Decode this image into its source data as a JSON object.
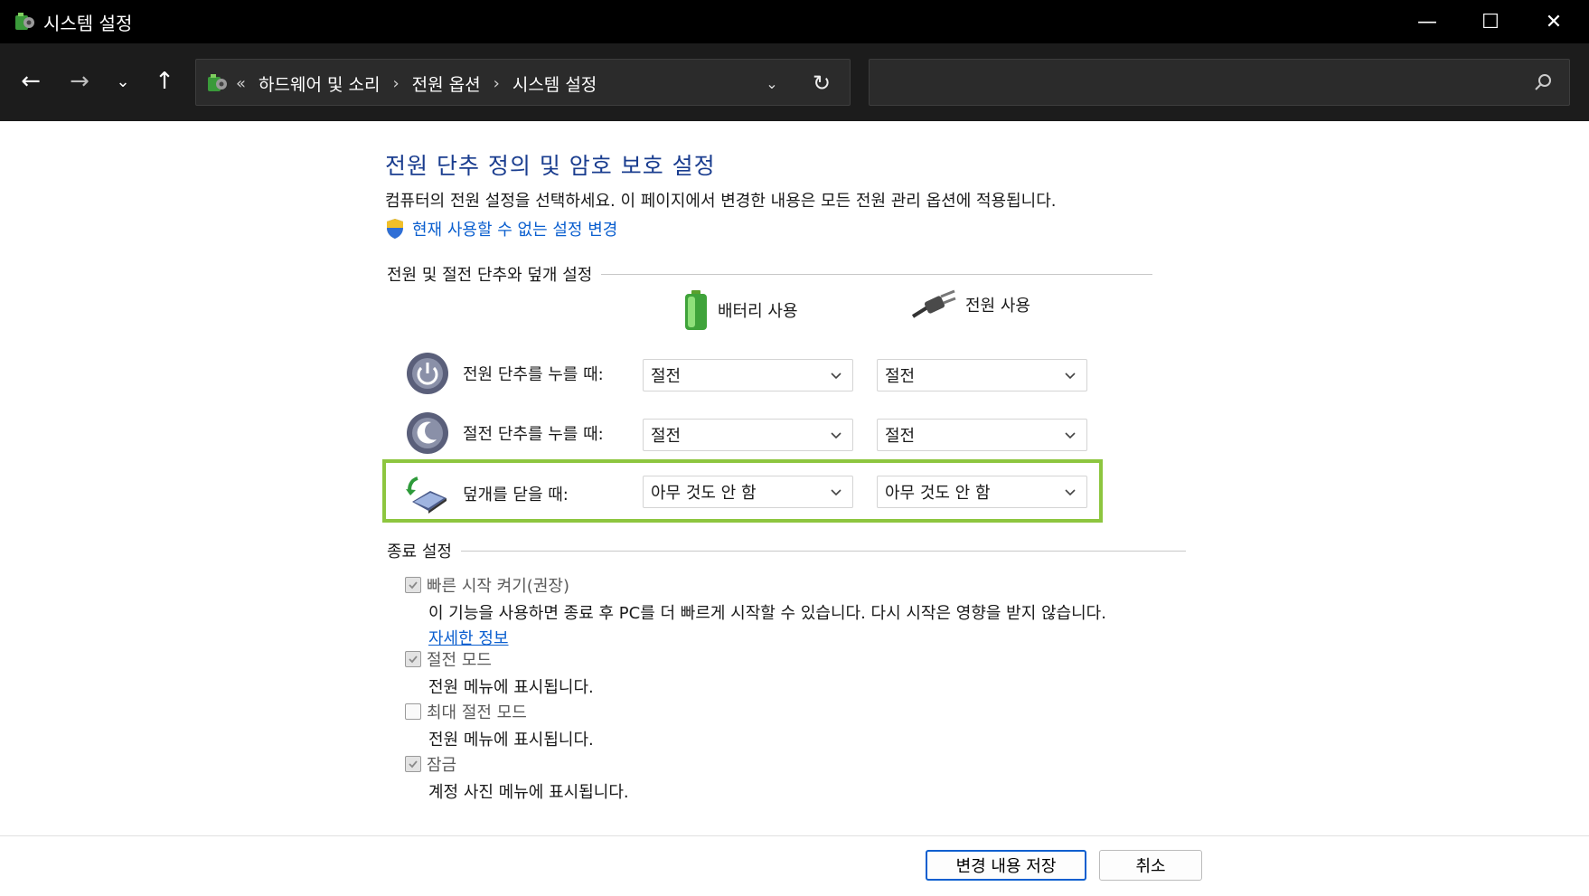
{
  "window": {
    "title": "시스템 설정",
    "minimize": "—",
    "maximize": "☐",
    "close": "✕"
  },
  "nav": {
    "back": "←",
    "forward": "→",
    "recent": "⌄",
    "up": "↑",
    "breadcrumb_prefix": "«",
    "breadcrumbs": [
      "하드웨어 및 소리",
      "전원 옵션",
      "시스템 설정"
    ],
    "separator": "›",
    "dropdown": "⌄",
    "refresh": "↻"
  },
  "search": {
    "placeholder": "",
    "value": ""
  },
  "page": {
    "heading": "전원 단추 정의 및 암호 보호 설정",
    "description": "컴퓨터의 전원 설정을 선택하세요. 이 페이지에서 변경한 내용은 모든 전원 관리 옵션에 적용됩니다.",
    "admin_link": "현재 사용할 수 없는 설정 변경"
  },
  "power_section": {
    "title": "전원 및 절전 단추와 덮개 설정",
    "col_battery": "배터리 사용",
    "col_plugged": "전원 사용",
    "rows": [
      {
        "label": "전원 단추를 누를 때:",
        "battery": "절전",
        "plugged": "절전"
      },
      {
        "label": "절전 단추를 누를 때:",
        "battery": "절전",
        "plugged": "절전"
      },
      {
        "label": "덮개를 닫을 때:",
        "battery": "아무 것도 안 함",
        "plugged": "아무 것도 안 함"
      }
    ]
  },
  "shutdown_section": {
    "title": "종료 설정",
    "items": [
      {
        "label": "빠른 시작 켜기(권장)",
        "checked": true,
        "desc": "이 기능을 사용하면 종료 후 PC를 더 빠르게 시작할 수 있습니다. 다시 시작은 영향을 받지 않습니다.",
        "link": "자세한 정보"
      },
      {
        "label": "절전 모드",
        "checked": true,
        "desc": "전원 메뉴에 표시됩니다."
      },
      {
        "label": "최대 절전 모드",
        "checked": false,
        "desc": "전원 메뉴에 표시됩니다."
      },
      {
        "label": "잠금",
        "checked": true,
        "desc": "계정 사진 메뉴에 표시됩니다."
      }
    ]
  },
  "buttons": {
    "save": "변경 내용 저장",
    "cancel": "취소"
  },
  "colors": {
    "heading": "#1a3d8f",
    "link": "#0b5fcf",
    "highlight": "#8dc63f",
    "titlebar": "#000000"
  }
}
